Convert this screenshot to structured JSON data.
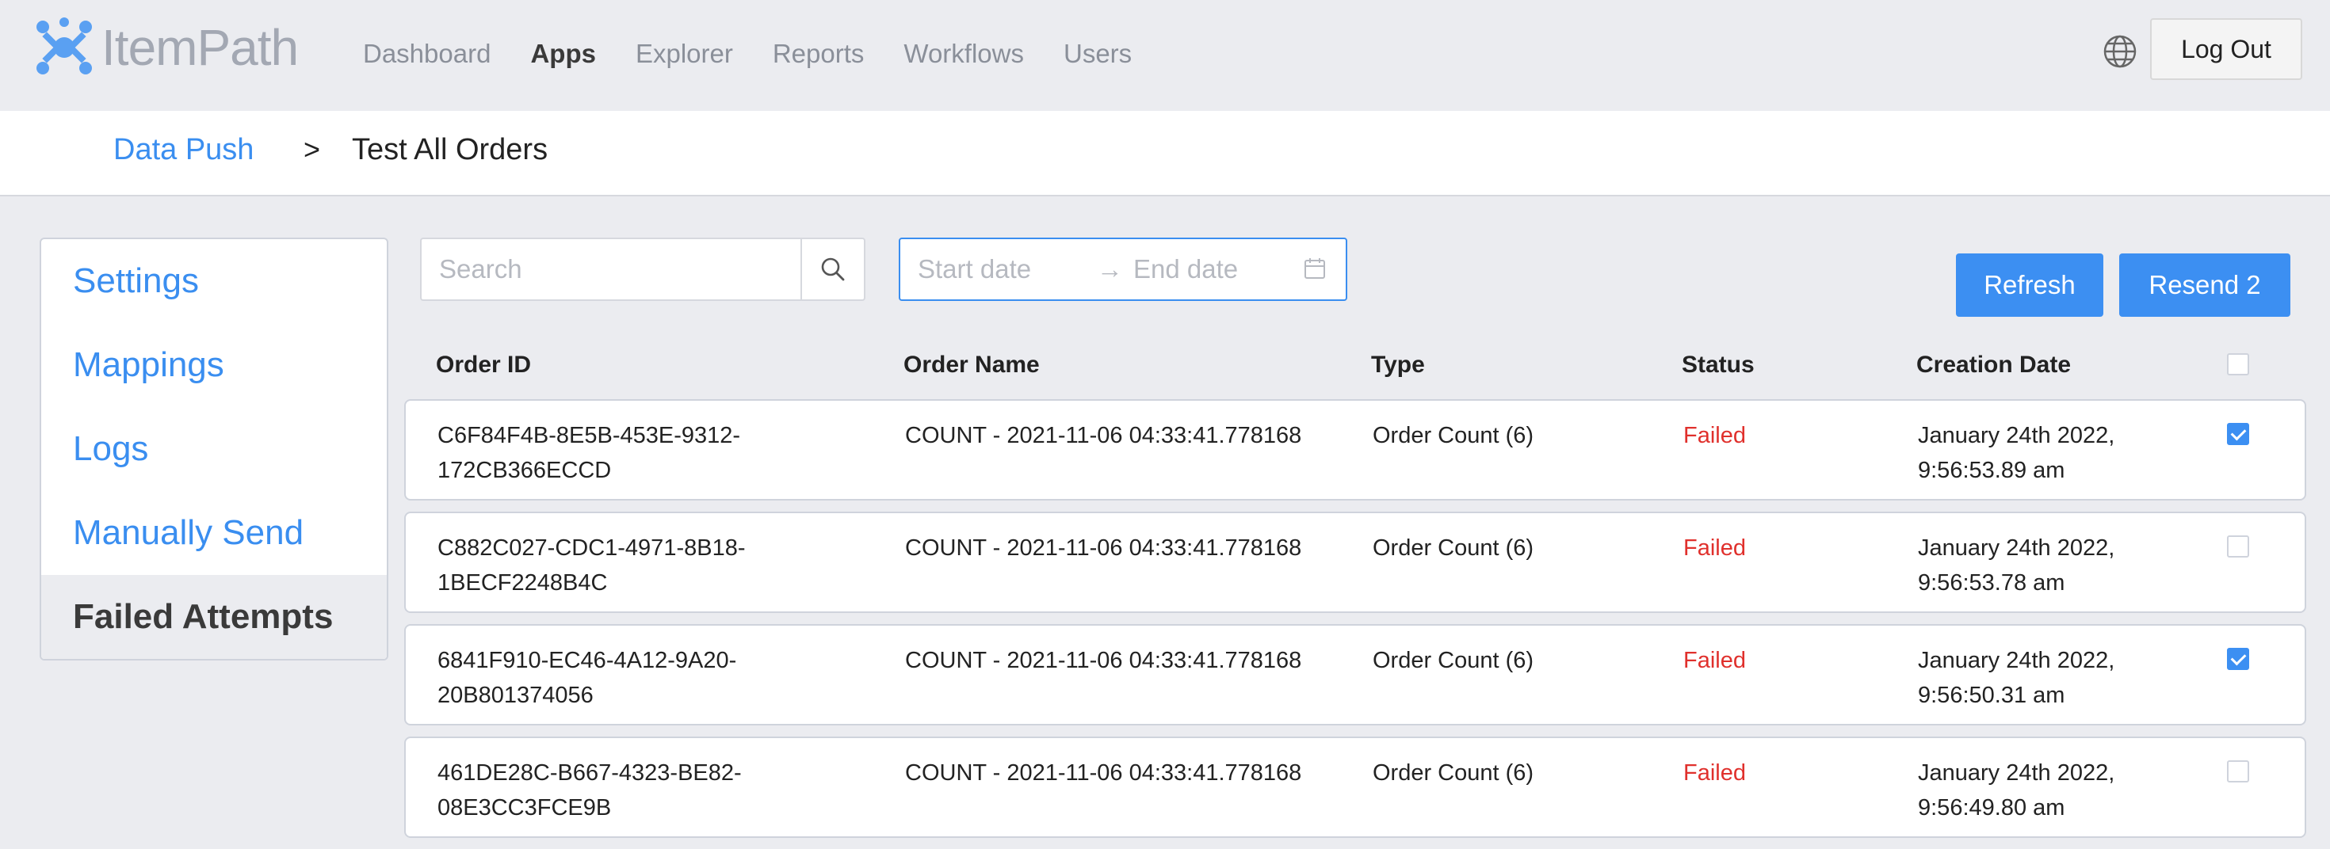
{
  "brand": {
    "name": "ItemPath",
    "accent": "#3a8ef0",
    "logo_color": "#5aa0f2"
  },
  "nav": {
    "items": [
      {
        "label": "Dashboard",
        "active": false
      },
      {
        "label": "Apps",
        "active": true
      },
      {
        "label": "Explorer",
        "active": false
      },
      {
        "label": "Reports",
        "active": false
      },
      {
        "label": "Workflows",
        "active": false
      },
      {
        "label": "Users",
        "active": false
      }
    ],
    "language_icon": "globe-icon",
    "logout_label": "Log Out"
  },
  "breadcrumb": {
    "parent": "Data Push",
    "separator": ">",
    "current": "Test All Orders"
  },
  "sidebar": {
    "items": [
      {
        "label": "Settings",
        "active": false
      },
      {
        "label": "Mappings",
        "active": false
      },
      {
        "label": "Logs",
        "active": false
      },
      {
        "label": "Manually Send",
        "active": false
      },
      {
        "label": "Failed Attempts",
        "active": true
      }
    ]
  },
  "toolbar": {
    "search_placeholder": "Search",
    "search_value": "",
    "search_icon": "search-icon",
    "start_date_placeholder": "Start date",
    "arrow": "→",
    "end_date_placeholder": "End date",
    "calendar_icon": "calendar-icon",
    "refresh_label": "Refresh",
    "resend_label": "Resend 2"
  },
  "table": {
    "columns": [
      "Order ID",
      "Order Name",
      "Type",
      "Status",
      "Creation Date"
    ],
    "select_all_checked": false,
    "status_color": "#e0302c",
    "rows": [
      {
        "order_id": "C6F84F4B-8E5B-453E-9312-172CB366ECCD",
        "order_name": "COUNT - 2021-11-06 04:33:41.778168",
        "type": "Order Count (6)",
        "status": "Failed",
        "creation_date": "January 24th 2022, 9:56:53.89 am",
        "checked": true
      },
      {
        "order_id": "C882C027-CDC1-4971-8B18-1BECF2248B4C",
        "order_name": "COUNT - 2021-11-06 04:33:41.778168",
        "type": "Order Count (6)",
        "status": "Failed",
        "creation_date": "January 24th 2022, 9:56:53.78 am",
        "checked": false
      },
      {
        "order_id": "6841F910-EC46-4A12-9A20-20B801374056",
        "order_name": "COUNT - 2021-11-06 04:33:41.778168",
        "type": "Order Count (6)",
        "status": "Failed",
        "creation_date": "January 24th 2022, 9:56:50.31 am",
        "checked": true
      },
      {
        "order_id": "461DE28C-B667-4323-BE82-08E3CC3FCE9B",
        "order_name": "COUNT - 2021-11-06 04:33:41.778168",
        "type": "Order Count (6)",
        "status": "Failed",
        "creation_date": "January 24th 2022, 9:56:49.80 am",
        "checked": false
      }
    ]
  }
}
